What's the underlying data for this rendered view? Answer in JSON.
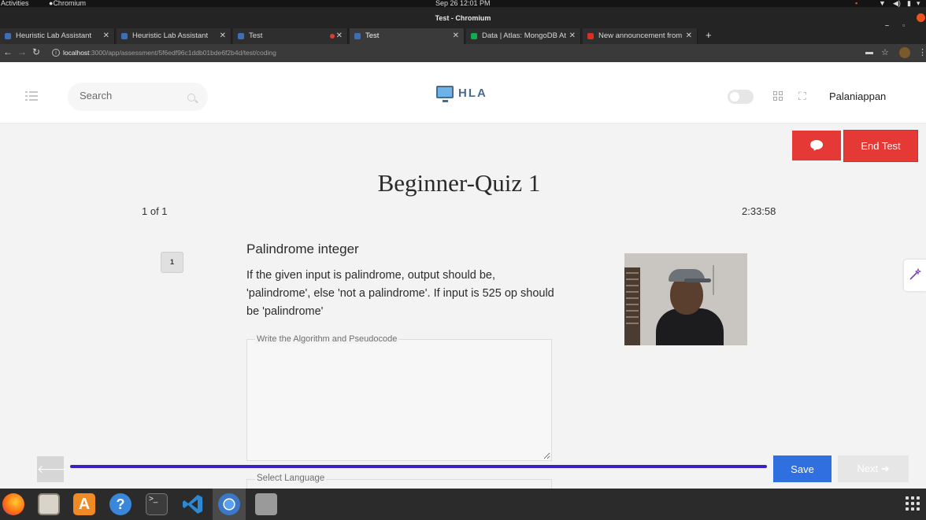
{
  "os_bar": {
    "activities": "Activities",
    "app_menu": "Chromium Web Browser ▾",
    "clock": "Sep 26  12:01 PM"
  },
  "window": {
    "title": "Test - Chromium"
  },
  "tabs": [
    {
      "label": "Heuristic Lab Assistant",
      "favicon_color": "#3d6fb6"
    },
    {
      "label": "Heuristic Lab Assistant",
      "favicon_color": "#3d6fb6"
    },
    {
      "label": "Test",
      "favicon_color": "#3d6fb6"
    },
    {
      "label": "Test",
      "favicon_color": "#3d6fb6"
    },
    {
      "label": "Data | Atlas: MongoDB At",
      "favicon_color": "#13aa52"
    },
    {
      "label": "New announcement from",
      "favicon_color": "#d93025"
    }
  ],
  "address": {
    "host": "localhost",
    "path": ":3000/app/assessment/5f6edf96c1ddb01bde6f2b4d/test/coding"
  },
  "header": {
    "search_placeholder": "Search",
    "logo_text": "HLA",
    "user_name": "Palaniappan"
  },
  "actions": {
    "end_test": "End Test"
  },
  "quiz": {
    "title": "Beginner-Quiz 1",
    "progress": "1 of 1",
    "timer": "2:33:58",
    "question_number": "1",
    "question_title": "Palindrome integer",
    "question_text": "If the given input is palindrome, output should be, 'palindrome', else 'not a palindrome'. If input is 525 op should be 'palindrome'",
    "algorithm_label": "Write the Algorithm and Pseudocode",
    "language_label": "Select Language"
  },
  "footer": {
    "save": "Save",
    "next": "Next",
    "progress_fraction": 1.0
  },
  "colors": {
    "danger": "#e53935",
    "primary": "#2f6fe0",
    "progress": "#3b1fc1"
  }
}
